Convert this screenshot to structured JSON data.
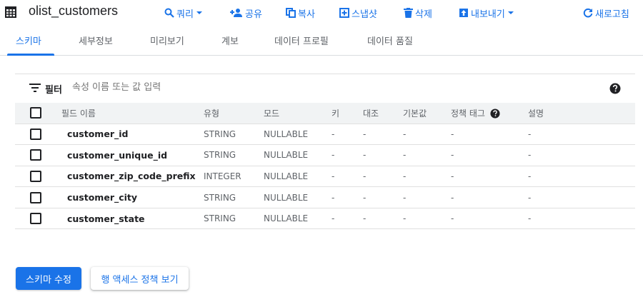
{
  "header": {
    "title": "olist_customers",
    "table_icon": "table-grid-icon",
    "actions": {
      "query": {
        "label": "쿼리",
        "icon": "search-icon"
      },
      "share": {
        "label": "공유",
        "icon": "add-person-icon"
      },
      "copy": {
        "label": "복사",
        "icon": "copy-icon"
      },
      "snapshot": {
        "label": "스냅샷",
        "icon": "snapshot-icon"
      },
      "delete": {
        "label": "삭제",
        "icon": "trash-icon"
      },
      "export": {
        "label": "내보내기",
        "icon": "upload-icon"
      },
      "refresh": {
        "label": "새로고침",
        "icon": "refresh-icon"
      }
    }
  },
  "tabs": [
    {
      "label": "스키마",
      "active": true
    },
    {
      "label": "세부정보",
      "active": false
    },
    {
      "label": "미리보기",
      "active": false
    },
    {
      "label": "계보",
      "active": false
    },
    {
      "label": "데이터 프로필",
      "active": false
    },
    {
      "label": "데이터 품질",
      "active": false
    }
  ],
  "filter": {
    "label": "필터",
    "placeholder": "속성 이름 또는 값 입력"
  },
  "table": {
    "headers": {
      "field_name": "필드 이름",
      "type": "유형",
      "mode": "모드",
      "key": "키",
      "collation": "대조",
      "default": "기본값",
      "policy_tags": "정책 태그",
      "description": "설명"
    },
    "rows": [
      {
        "name": "customer_id",
        "type": "STRING",
        "mode": "NULLABLE",
        "key": "-",
        "collation": "-",
        "default": "-",
        "policy_tags": "-",
        "description": "-"
      },
      {
        "name": "customer_unique_id",
        "type": "STRING",
        "mode": "NULLABLE",
        "key": "-",
        "collation": "-",
        "default": "-",
        "policy_tags": "-",
        "description": "-"
      },
      {
        "name": "customer_zip_code_prefix",
        "type": "INTEGER",
        "mode": "NULLABLE",
        "key": "-",
        "collation": "-",
        "default": "-",
        "policy_tags": "-",
        "description": "-"
      },
      {
        "name": "customer_city",
        "type": "STRING",
        "mode": "NULLABLE",
        "key": "-",
        "collation": "-",
        "default": "-",
        "policy_tags": "-",
        "description": "-"
      },
      {
        "name": "customer_state",
        "type": "STRING",
        "mode": "NULLABLE",
        "key": "-",
        "collation": "-",
        "default": "-",
        "policy_tags": "-",
        "description": "-"
      }
    ]
  },
  "buttons": {
    "edit_schema": "스키마 수정",
    "row_access_policy": "행 액세스 정책 보기"
  },
  "colors": {
    "accent": "#1a73e8",
    "text": "#202124",
    "muted": "#5f6368",
    "header_bg": "#f1f3f4",
    "divider": "#e0e0e0"
  }
}
